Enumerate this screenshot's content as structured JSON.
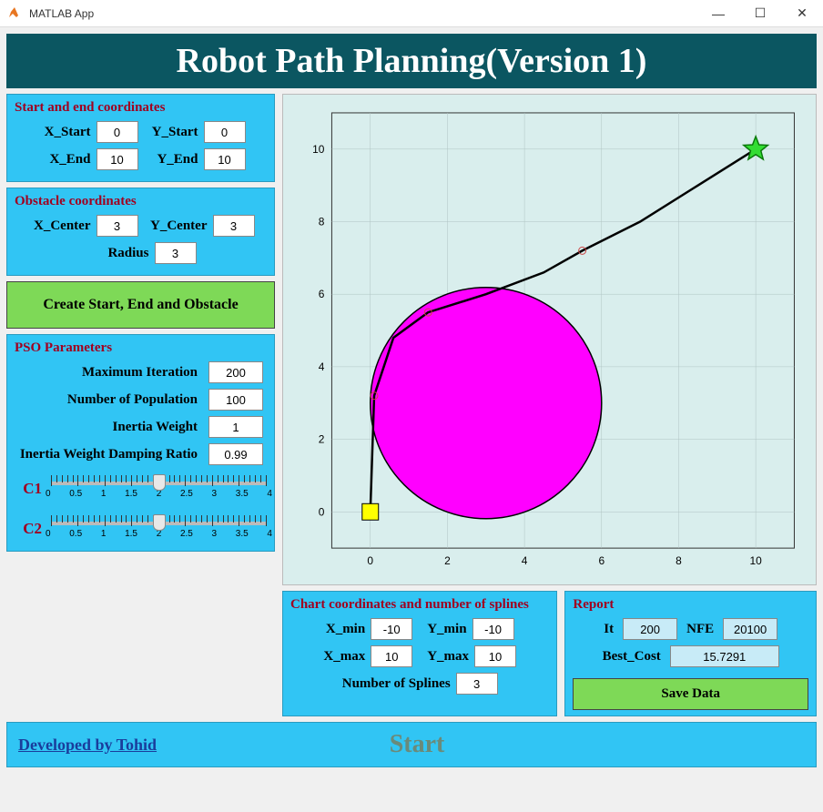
{
  "window": {
    "title": "MATLAB App"
  },
  "banner": {
    "title": "Robot Path Planning(Version 1)"
  },
  "coords": {
    "title": "Start and end coordinates",
    "xstart_lbl": "X_Start",
    "xstart": "0",
    "ystart_lbl": "Y_Start",
    "ystart": "0",
    "xend_lbl": "X_End",
    "xend": "10",
    "yend_lbl": "Y_End",
    "yend": "10"
  },
  "obstacle": {
    "title": "Obstacle coordinates",
    "xc_lbl": "X_Center",
    "xc": "3",
    "yc_lbl": "Y_Center",
    "yc": "3",
    "r_lbl": "Radius",
    "r": "3"
  },
  "createbtn": "Create Start, End and Obstacle",
  "pso": {
    "title": "PSO Parameters",
    "maxit_lbl": "Maximum Iteration",
    "maxit": "200",
    "npop_lbl": "Number of Population",
    "npop": "100",
    "w_lbl": "Inertia Weight",
    "w": "1",
    "wd_lbl": "Inertia Weight Damping Ratio",
    "wd": "0.99",
    "c1_lbl": "C1",
    "c2_lbl": "C2",
    "ticks": [
      "0",
      "0.5",
      "1",
      "1.5",
      "2",
      "2.5",
      "3",
      "3.5",
      "4"
    ],
    "c1_pos_pct": 50,
    "c2_pos_pct": 50
  },
  "chartcoords": {
    "title": "Chart coordinates and number of splines",
    "xmin_lbl": "X_min",
    "xmin": "-10",
    "ymin_lbl": "Y_min",
    "ymin": "-10",
    "xmax_lbl": "X_max",
    "xmax": "10",
    "ymax_lbl": "Y_max",
    "ymax": "10",
    "ns_lbl": "Number of Splines",
    "ns": "3"
  },
  "report": {
    "title": "Report",
    "it_lbl": "It",
    "it": "200",
    "nfe_lbl": "NFE",
    "nfe": "20100",
    "bc_lbl": "Best_Cost",
    "bc": "15.7291",
    "save": "Save Data"
  },
  "footer": {
    "credit": "Developed by Tohid",
    "start": "Start"
  },
  "chart_data": {
    "type": "line",
    "xlim": [
      -1,
      11
    ],
    "ylim": [
      -1,
      11
    ],
    "xticks": [
      0,
      2,
      4,
      6,
      8,
      10
    ],
    "yticks": [
      0,
      2,
      4,
      6,
      8,
      10
    ],
    "obstacle": {
      "cx": 3,
      "cy": 3,
      "r": 3,
      "color": "#ff00ff"
    },
    "start_marker": {
      "x": 0,
      "y": 0,
      "shape": "square",
      "color": "#ffff00"
    },
    "end_marker": {
      "x": 10,
      "y": 10,
      "shape": "star",
      "color": "#33dd33"
    },
    "path": [
      [
        0,
        0
      ],
      [
        0.05,
        1.6
      ],
      [
        0.1,
        3.2
      ],
      [
        0.6,
        4.8
      ],
      [
        1.5,
        5.5
      ],
      [
        3.0,
        6.0
      ],
      [
        4.5,
        6.6
      ],
      [
        5.5,
        7.2
      ],
      [
        7.0,
        8.0
      ],
      [
        8.5,
        9.0
      ],
      [
        10,
        10
      ]
    ],
    "control_points": [
      [
        0.1,
        3.2
      ],
      [
        1.5,
        5.5
      ],
      [
        5.5,
        7.2
      ]
    ]
  }
}
